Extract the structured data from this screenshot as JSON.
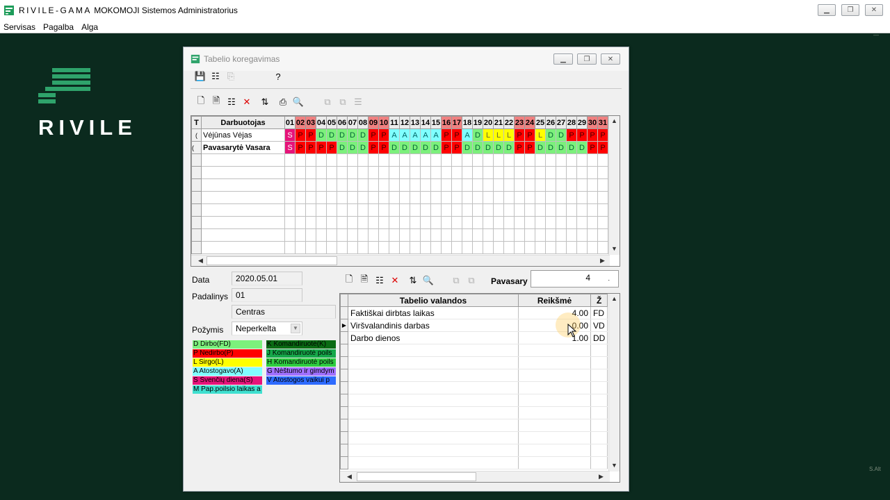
{
  "app": {
    "title_brand": "RIVILE-GAMA",
    "title_rest": "MOKOMOJI  Sistemos Administratorius",
    "menu": [
      "Servisas",
      "Pagalba",
      "Alga"
    ]
  },
  "logo": {
    "word": "RIVILE"
  },
  "desktop": {
    "corner_top": "—",
    "corner_bottom": "S.Alt"
  },
  "dialog": {
    "title": "Tabelio koregavimas",
    "timesheet": {
      "col_marker": "T",
      "col_employee": "Darbuotojas",
      "days": [
        "01",
        "02",
        "03",
        "04",
        "05",
        "06",
        "07",
        "08",
        "09",
        "10",
        "11",
        "12",
        "13",
        "14",
        "15",
        "16",
        "17",
        "18",
        "19",
        "20",
        "21",
        "22",
        "23",
        "24",
        "25",
        "26",
        "27",
        "28",
        "29",
        "30",
        "31"
      ],
      "red_days": [
        "02",
        "03",
        "09",
        "10",
        "16",
        "17",
        "23",
        "24",
        "30",
        "31"
      ],
      "rows": [
        {
          "ind": "(",
          "name": "Vėjūnas Vėjas",
          "codes": [
            "S",
            "P",
            "P",
            "D",
            "D",
            "D",
            "D",
            "D",
            "P",
            "P",
            "A",
            "A",
            "A",
            "A",
            "A",
            "P",
            "P",
            "A",
            "D",
            "L",
            "L",
            "L",
            "P",
            "P",
            "L",
            "D",
            "D",
            "P",
            "P",
            "P",
            "P"
          ]
        },
        {
          "ind": "(",
          "name": "Pavasarytė Vasara",
          "codes": [
            "S",
            "P",
            "P",
            "P",
            "P",
            "D",
            "D",
            "D",
            "P",
            "P",
            "D",
            "D",
            "D",
            "D",
            "D",
            "P",
            "P",
            "D",
            "D",
            "D",
            "D",
            "D",
            "P",
            "P",
            "D",
            "D",
            "D",
            "D",
            "D",
            "P",
            "P"
          ]
        }
      ]
    },
    "form": {
      "data_label": "Data",
      "data_value": "2020.05.01",
      "padalinys_label": "Padalinys",
      "padalinys_value": "01",
      "padalinys_name": "Centras",
      "pozymis_label": "Požymis",
      "pozymis_value": "Neperkelta"
    },
    "legend_left": [
      {
        "text": "D Dirbo(FD)",
        "color": "#7cf07c"
      },
      {
        "text": "P Nedirbo(P)",
        "color": "#ff0000"
      },
      {
        "text": "L Sirgo(L)",
        "color": "#ffff00"
      },
      {
        "text": "A Atostogavo(A)",
        "color": "#80ffff"
      },
      {
        "text": "S Švenčių diena(S)",
        "color": "#e6147a"
      },
      {
        "text": "M Pap.poilsio laikas a",
        "color": "#40e0d0"
      }
    ],
    "legend_right": [
      {
        "text": "K Komandiruotė(K)",
        "color": "#0a6b14"
      },
      {
        "text": "J Komandiruotė poils",
        "color": "#16a84a"
      },
      {
        "text": "H Komandiruotė poils",
        "color": "#2ecc40"
      },
      {
        "text": "G Nėštumo ir gimdym",
        "color": "#a070ff"
      },
      {
        "text": "V Atostogos vaikui p",
        "color": "#2e6bff"
      }
    ],
    "detail": {
      "employee_label": "Pavasary",
      "entry_value": "4",
      "entry_suffix": ".",
      "col_name": "Tabelio valandos",
      "col_value": "Reikšmė",
      "col_code": "Ž",
      "rows": [
        {
          "name": "Faktiškai dirbtas laikas",
          "value": "4.00",
          "code": "FD"
        },
        {
          "name": "Viršvalandinis darbas",
          "value": "0.00",
          "code": "VD"
        },
        {
          "name": "Darbo dienos",
          "value": "1.00",
          "code": "DD"
        }
      ]
    }
  }
}
